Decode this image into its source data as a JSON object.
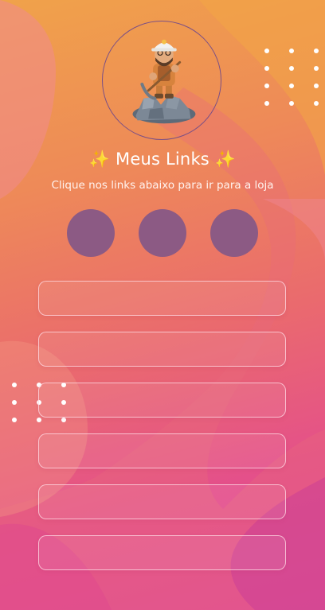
{
  "header": {
    "title": "✨ Meus Links ✨",
    "subtitle": "Clique nos links abaixo para ir para a loja"
  },
  "avatar": {
    "icon": "miner-figure-icon"
  },
  "social": [
    {
      "icon": "social-icon-1",
      "label": ""
    },
    {
      "icon": "social-icon-2",
      "label": ""
    },
    {
      "icon": "social-icon-3",
      "label": ""
    }
  ],
  "links": [
    {
      "label": ""
    },
    {
      "label": ""
    },
    {
      "label": ""
    },
    {
      "label": ""
    },
    {
      "label": ""
    },
    {
      "label": ""
    }
  ],
  "colors": {
    "circle_fill": "#8c5a84",
    "avatar_border": "#7a4f86",
    "text": "#ffffff"
  }
}
